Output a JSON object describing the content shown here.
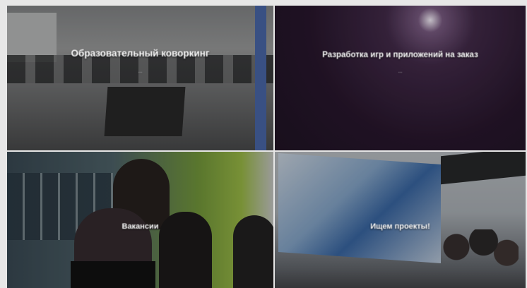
{
  "tiles": [
    {
      "title": "Образовательный коворкинг",
      "subtitle": "..."
    },
    {
      "title": "Разработка игр и приложений на заказ",
      "subtitle": "..."
    },
    {
      "title": "Вакансии"
    },
    {
      "title": "Ищем проекты!"
    }
  ]
}
